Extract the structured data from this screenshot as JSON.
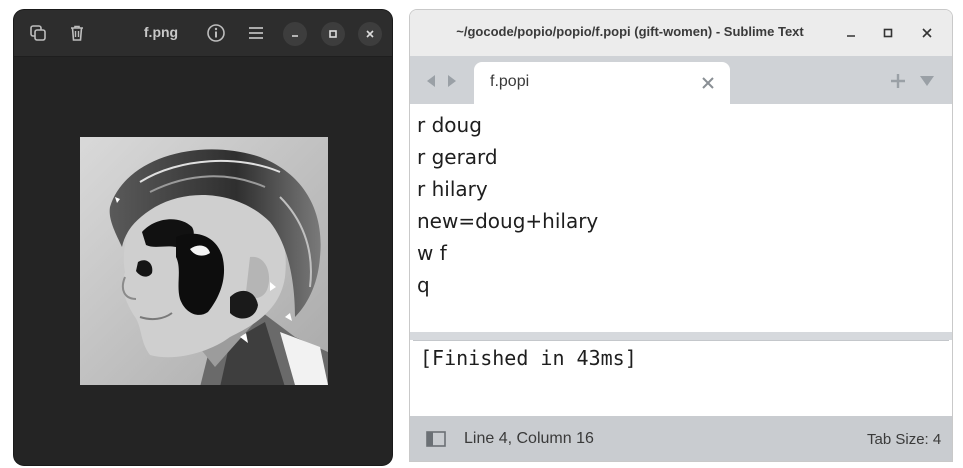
{
  "viewer": {
    "title": "f.png",
    "icons": [
      "copy-icon",
      "trash-icon",
      "info-icon",
      "menu-icon",
      "minimize-icon",
      "maximize-icon",
      "close-icon"
    ],
    "colors": {
      "background": "#242424",
      "header": "#2d2d2d"
    }
  },
  "sublime": {
    "window_title": "~/gocode/popio/popio/f.popi (gift-women) - Sublime Text",
    "tab": {
      "label": "f.popi"
    },
    "code_lines": [
      "r doug",
      "r gerard",
      "r hilary",
      "new=doug+hilary",
      "w f",
      "q"
    ],
    "console_output": "[Finished in 43ms]",
    "status": {
      "position": "Line 4, Column 16",
      "tab_size": "Tab Size: 4"
    },
    "colors": {
      "tabbar": "#cfd2d6",
      "statusbar": "#c9ccd0",
      "text": "#1e1e1e"
    }
  }
}
